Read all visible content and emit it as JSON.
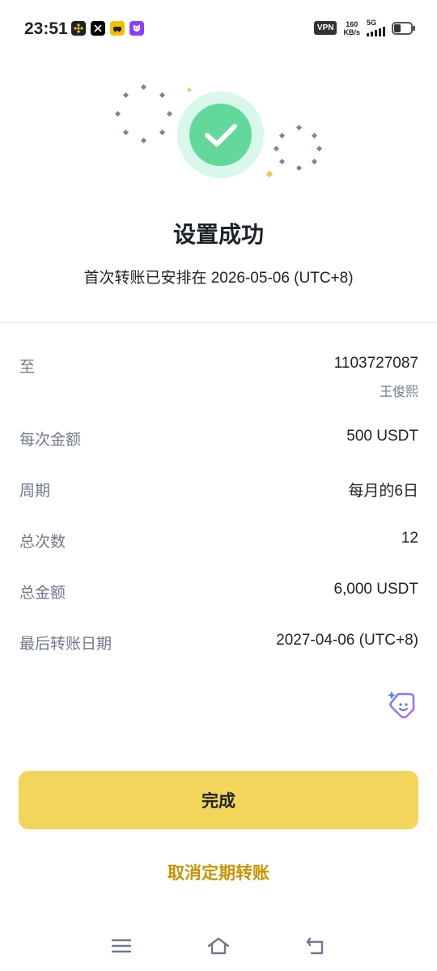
{
  "status_bar": {
    "time": "23:51",
    "vpn": "VPN",
    "speed_value": "160",
    "speed_unit": "KB/s",
    "network": "5G",
    "app_icons": [
      "binance-icon",
      "x-icon",
      "taxi-icon",
      "cat-icon"
    ]
  },
  "result": {
    "title": "设置成功",
    "subtitle": "首次转账已安排在 2026-05-06 (UTC+8)",
    "icon": "check-icon",
    "accent_color": "#62d89a"
  },
  "details": {
    "to_label": "至",
    "to_value": "1103727087",
    "to_name": "王俊熙",
    "amount_label": "每次金额",
    "amount_value": "500 USDT",
    "period_label": "周期",
    "period_value": "每月的6日",
    "count_label": "总次数",
    "count_value": "12",
    "total_label": "总金额",
    "total_value": "6,000 USDT",
    "last_label": "最后转账日期",
    "last_value": "2027-04-06 (UTC+8)"
  },
  "actions": {
    "done_label": "完成",
    "cancel_label": "取消定期转账",
    "primary_color": "#f4d55c",
    "link_color": "#c99400"
  },
  "nav": {
    "icons": [
      "menu-icon",
      "home-icon",
      "back-icon"
    ]
  }
}
